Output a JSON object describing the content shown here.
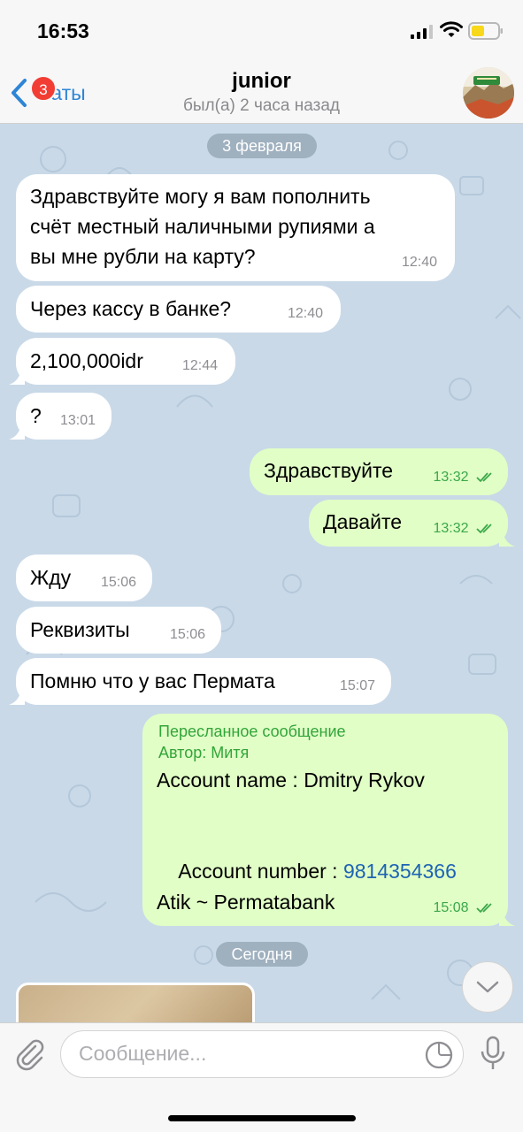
{
  "status_bar": {
    "time": "16:53"
  },
  "nav": {
    "back_label": "Чаты",
    "unread_badge": "3",
    "title": "junior",
    "status": "был(а) 2 часа назад"
  },
  "dates": {
    "first": "3 февраля",
    "second": "Сегодня"
  },
  "messages": [
    {
      "dir": "in",
      "lines": [
        "Здравствуйте могу я вам пополнить",
        "счёт местный наличными рупиями а",
        "вы мне рубли на карту?"
      ],
      "time": "12:40"
    },
    {
      "dir": "in",
      "text": "Через кассу в банке?",
      "time": "12:40"
    },
    {
      "dir": "in",
      "text": "2,100,000idr",
      "time": "12:44"
    },
    {
      "dir": "in",
      "text": "?",
      "time": "13:01"
    },
    {
      "dir": "out",
      "text": "Здравствуйте",
      "time": "13:32"
    },
    {
      "dir": "out",
      "text": "Давайте",
      "time": "13:32"
    },
    {
      "dir": "in",
      "text": "Жду",
      "time": "15:06"
    },
    {
      "dir": "in",
      "text": "Реквизиты",
      "time": "15:06"
    },
    {
      "dir": "in",
      "text": "Помню что у вас Пермата",
      "time": "15:07"
    }
  ],
  "forwarded": {
    "header": "Пересланное сообщение",
    "author": "Автор: Митя",
    "account_name_line": "Account name : Dmitry Rykov",
    "account_number_label": "Account number : ",
    "account_number": "9814354366",
    "bank_line": "Atik ~ Permatabank",
    "time": "15:08"
  },
  "input": {
    "placeholder": "Сообщение..."
  },
  "colors": {
    "accent": "#2e85d6",
    "outgoing_bubble": "#e1fec6",
    "incoming_bubble": "#ffffff",
    "chat_background": "#c9d9e8",
    "read_ticks": "#3aa84a",
    "badge": "#f23d35"
  }
}
